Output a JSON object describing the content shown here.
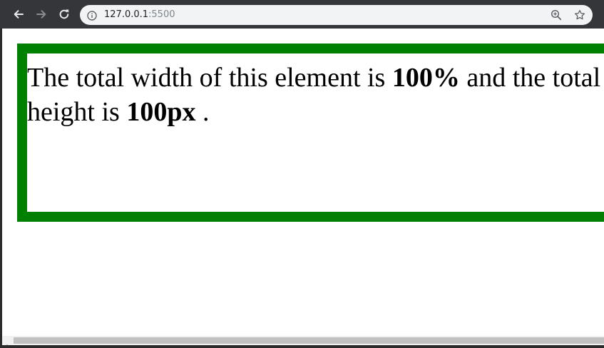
{
  "browser": {
    "url_host": "127.0.0.1",
    "url_port": ":5500",
    "icons": {
      "back": "arrow-left-icon",
      "forward": "arrow-right-icon",
      "reload": "reload-icon",
      "site_info": "info-icon",
      "zoom": "zoom-icon",
      "bookmark": "star-icon"
    }
  },
  "page": {
    "text_before_width": "The total width of this element is ",
    "width_value": "100%",
    "text_middle": " and the total height is ",
    "height_value": "100px",
    "text_end": " .",
    "box_border_color": "#008000"
  }
}
